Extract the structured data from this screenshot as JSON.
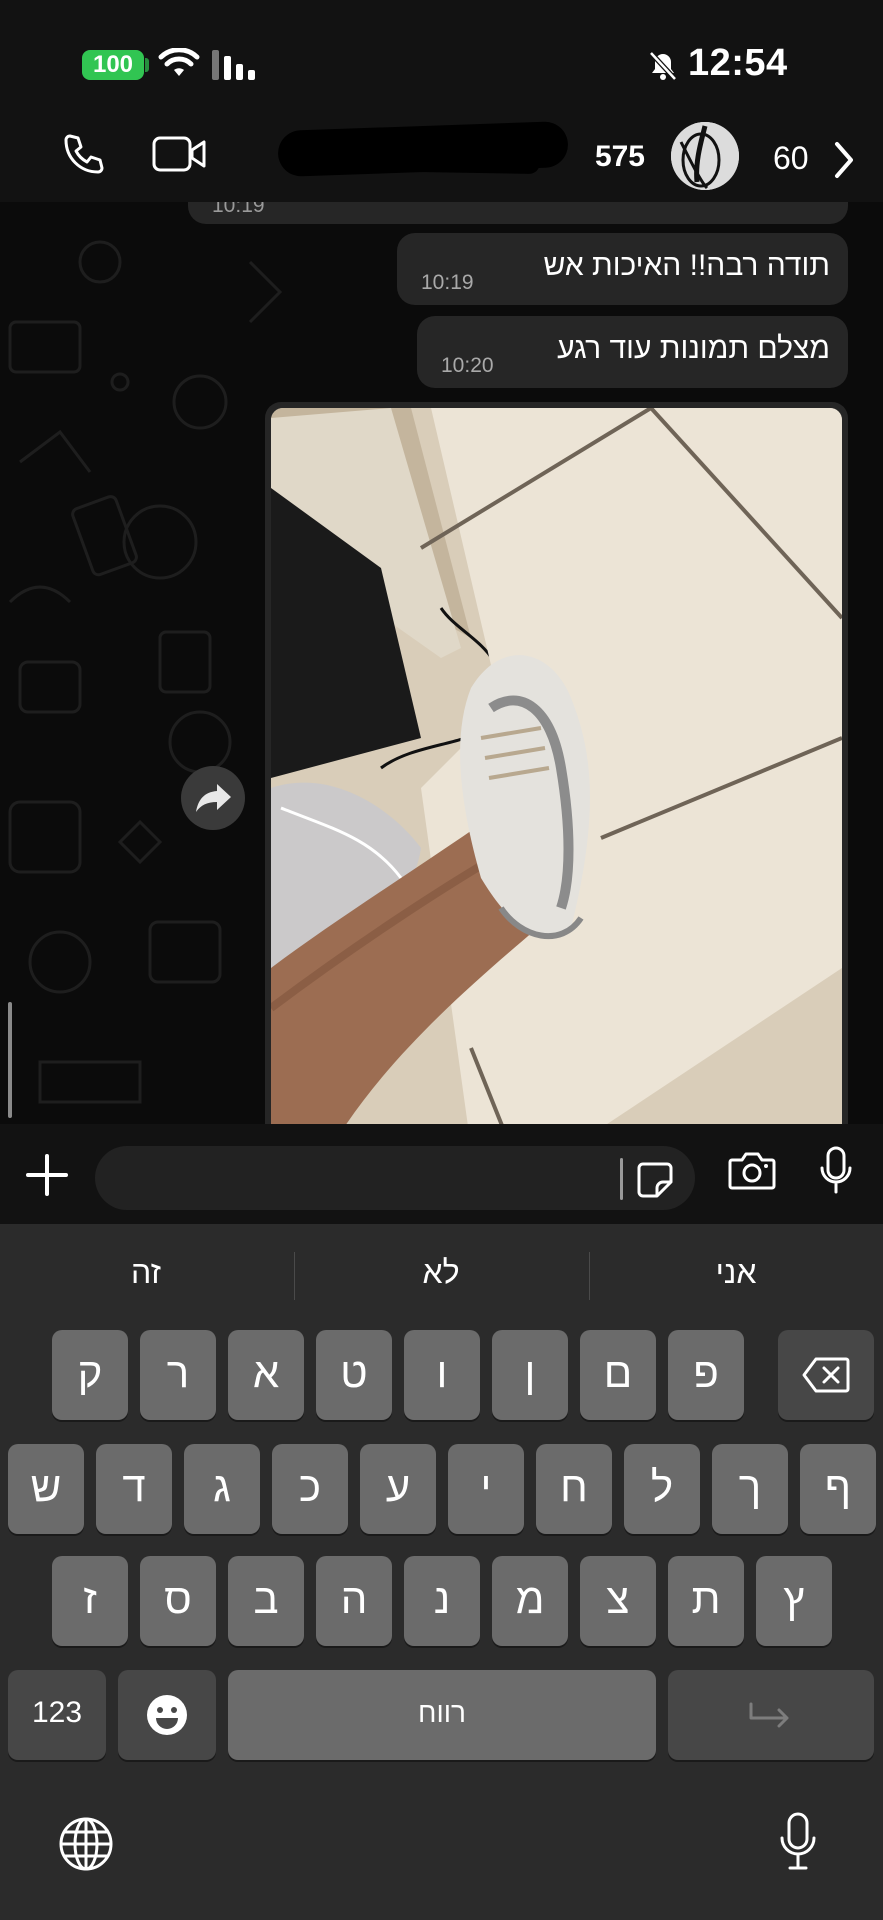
{
  "status_bar": {
    "battery": "100",
    "time": "12:54"
  },
  "header": {
    "contact_name": "575",
    "count": "60"
  },
  "messages": [
    {
      "text": "",
      "time": "10:19"
    },
    {
      "text": "תודה רבה!! האיכות אש",
      "time": "10:19"
    },
    {
      "text": "מצלם תמונות עוד רגע",
      "time": "10:20"
    }
  ],
  "input": {
    "placeholder": ""
  },
  "keyboard": {
    "suggestions": [
      "זה",
      "לא",
      "אני"
    ],
    "row1": [
      "ק",
      "ר",
      "א",
      "ט",
      "ו",
      "ן",
      "ם",
      "פ"
    ],
    "row2": [
      "ש",
      "ד",
      "ג",
      "כ",
      "ע",
      "י",
      "ח",
      "ל",
      "ך",
      "ף"
    ],
    "row3": [
      "ז",
      "ס",
      "ב",
      "ה",
      "נ",
      "מ",
      "צ",
      "ת",
      "ץ"
    ],
    "numbers_label": "123",
    "space_label": "רווח"
  },
  "colors": {
    "battery": "#31c552",
    "bubble": "#262626",
    "key": "#6b6b6b",
    "key_dark": "#474747"
  },
  "icons": [
    "phone-icon",
    "video-icon",
    "chevron-right-icon",
    "forward-icon",
    "plus-icon",
    "sticker-icon",
    "camera-icon",
    "microphone-icon",
    "backspace-icon",
    "emoji-icon",
    "return-icon",
    "globe-icon"
  ]
}
